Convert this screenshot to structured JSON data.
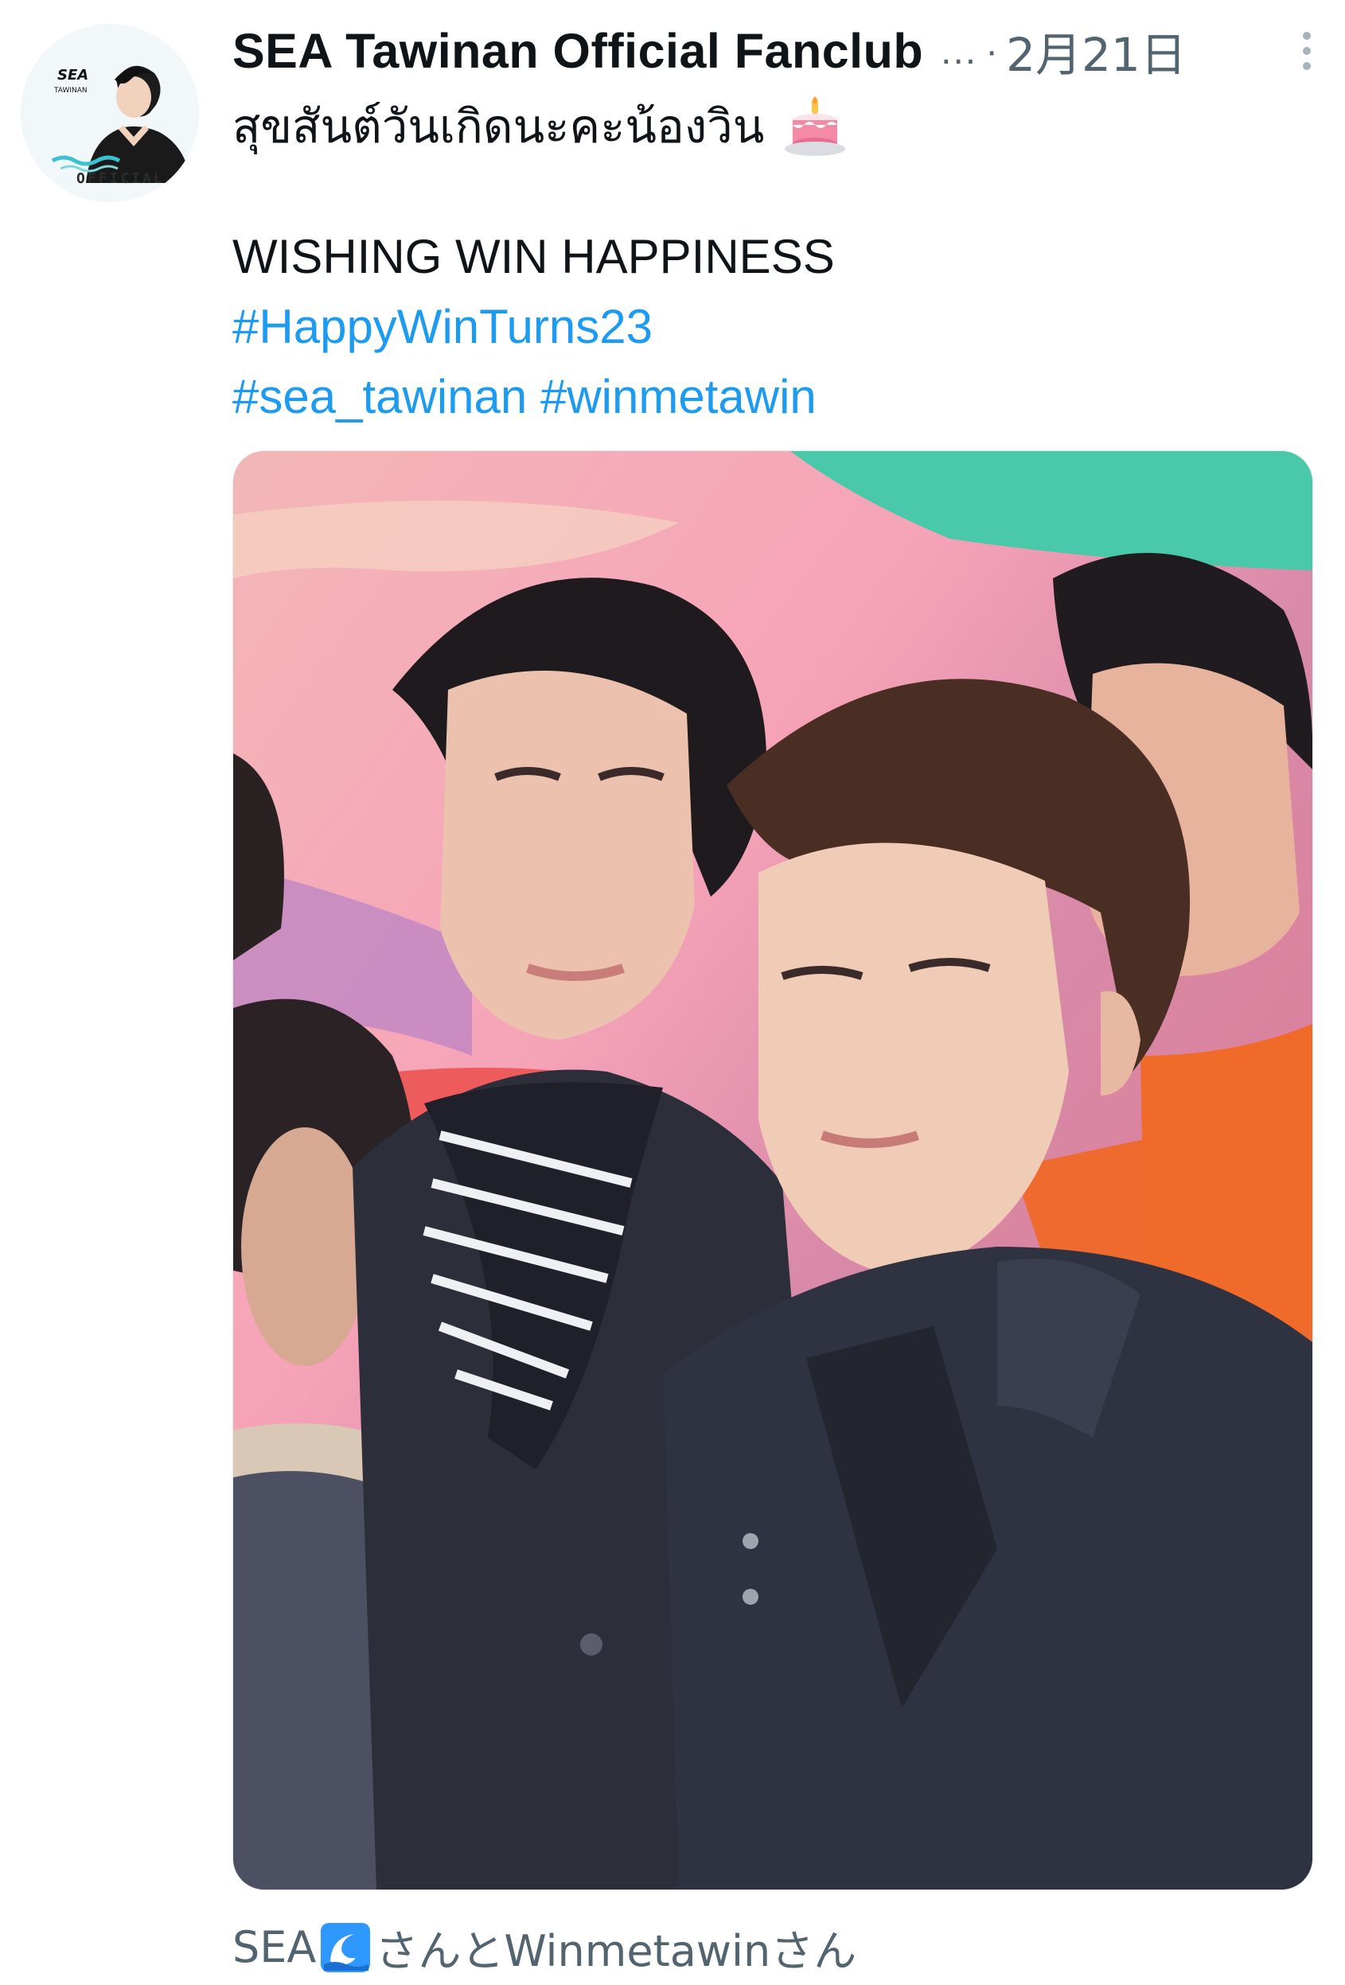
{
  "tweet": {
    "author": {
      "display_name": "SEA Tawinan Official Fanclub",
      "truncation": "...",
      "avatar_text_top": "SEA",
      "avatar_text_sub": "TAWINAN",
      "avatar_text_bottom": "OFFICIAL"
    },
    "separator": "·",
    "timestamp": "2月21日",
    "text_thai": "สุขสันต์วันเกิดนะคะน้องวิน",
    "text_wish": "WISHING WIN HAPPINESS",
    "hashtags": [
      "#HappyWinTurns23",
      "#sea_tawinan",
      "#winmetawin"
    ],
    "media_tags": {
      "prefix": "SEA",
      "suffix": "さんとWinmetawinさん"
    }
  },
  "icons": {
    "more": "more-vertical-icon",
    "cake": "birthday-cake-icon",
    "wave": "water-wave-icon"
  },
  "colors": {
    "link": "#1d9bf0",
    "secondary_text": "#536471",
    "primary_text": "#0f1419"
  }
}
